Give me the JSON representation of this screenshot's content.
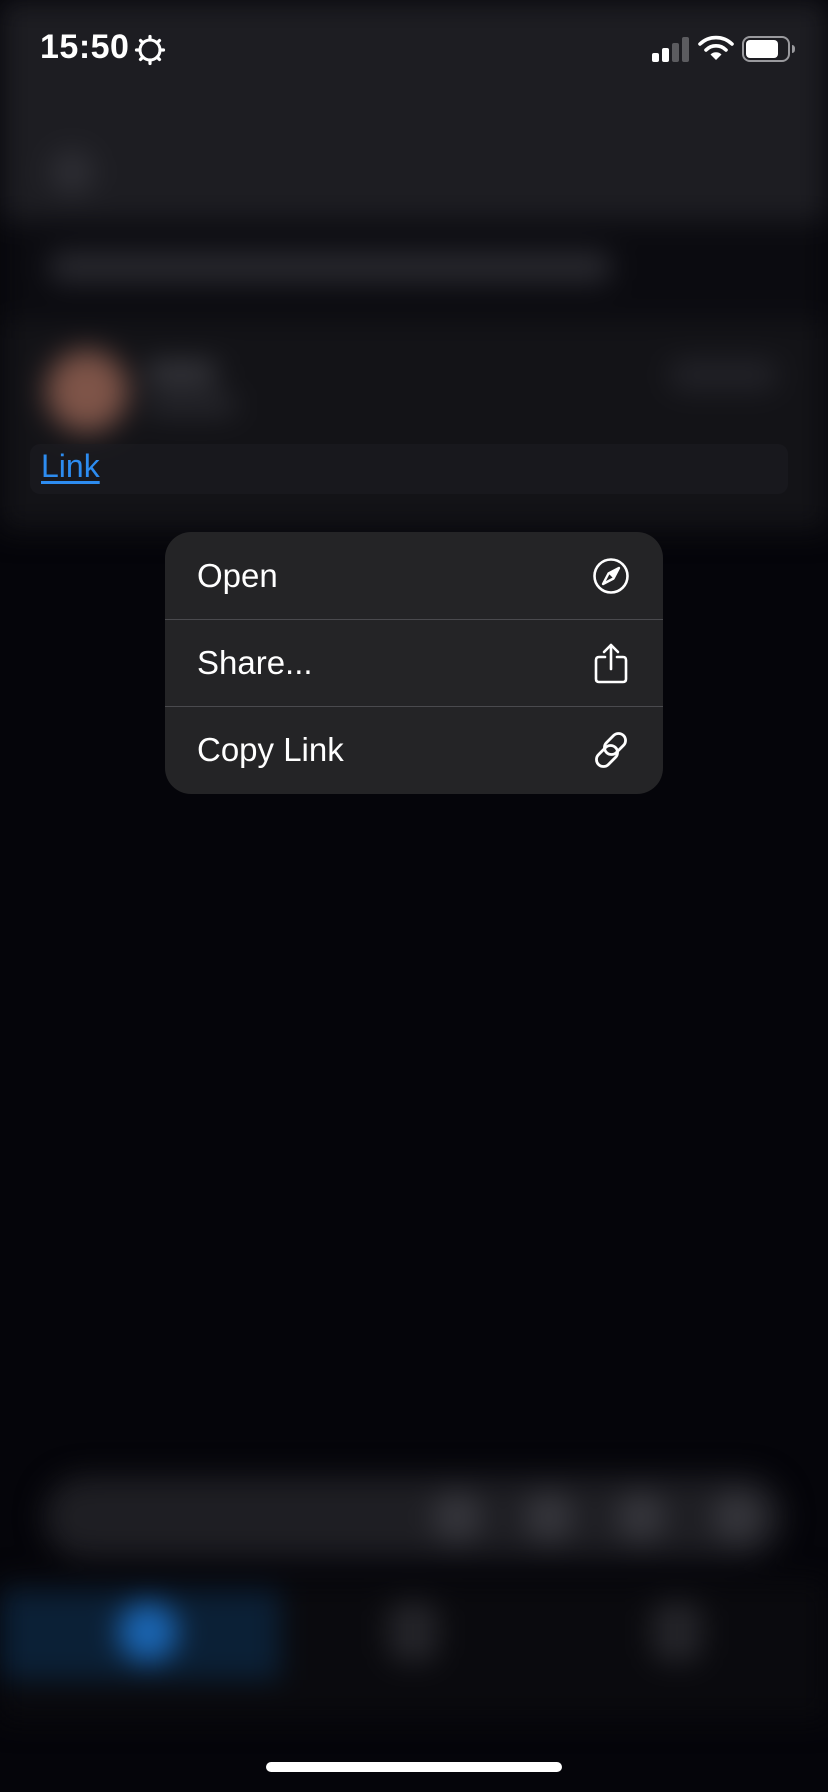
{
  "status_bar": {
    "time": "15:50"
  },
  "content": {
    "link_label": "Link"
  },
  "context_menu": {
    "items": [
      {
        "label": "Open",
        "icon": "compass-icon"
      },
      {
        "label": "Share...",
        "icon": "share-icon"
      },
      {
        "label": "Copy Link",
        "icon": "link-icon"
      }
    ]
  },
  "colors": {
    "link": "#2d8cf0",
    "menu_background": "#242426",
    "accent_tab": "#1a64b0"
  }
}
